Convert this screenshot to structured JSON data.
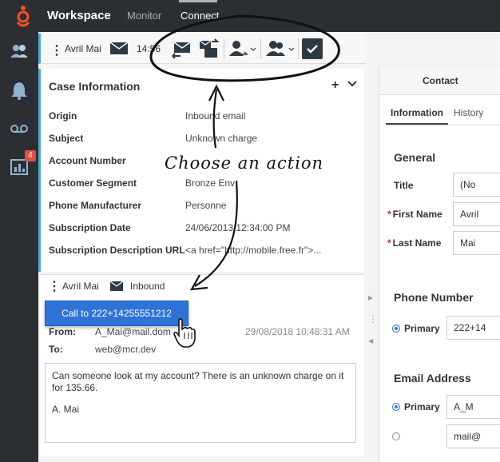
{
  "topbar": {
    "app_title": "Workspace",
    "nav": [
      "Monitor",
      "Connect"
    ]
  },
  "leftbar": {
    "badge_count": "4"
  },
  "toolbar": {
    "name": "Avril Mai",
    "time": "14:56"
  },
  "case": {
    "title": "Case Information",
    "rows": [
      {
        "label": "Origin",
        "value": "Inbound email"
      },
      {
        "label": "Subject",
        "value": "Unknown charge"
      },
      {
        "label": "Account Number",
        "value": ""
      },
      {
        "label": "Customer Segment",
        "value": "Bronze Env"
      },
      {
        "label": "Phone Manufacturer",
        "value": "Personne"
      },
      {
        "label": "Subscription Date",
        "value": "24/06/2013 12:34:00 PM"
      },
      {
        "label": "Subscription Description URL",
        "value": "<a href=\"http://mobile.free.fr\">..."
      }
    ]
  },
  "interaction": {
    "name": "Avril Mai",
    "channel": "Inbound"
  },
  "call_menu": {
    "label": "Call to 222+14255551212"
  },
  "email": {
    "from_label": "From:",
    "from_value": "A_Mai@mail.dom",
    "to_label": "To:",
    "to_value": "web@mcr.dev",
    "date": "29/08/2018 10:48:31 AM",
    "body_line1": "Can someone look at my account? There is an unknown charge on it for 135.66.",
    "body_line2": "A. Mai"
  },
  "contact": {
    "header": "Contact",
    "tabs": [
      "Information",
      "History"
    ],
    "general": "General",
    "title_label": "Title",
    "title_value": "(No",
    "first_name_label": "First Name",
    "first_name_value": "Avril",
    "last_name_label": "Last Name",
    "last_name_value": "Mai",
    "phone_section": "Phone Number",
    "phone_primary_label": "Primary",
    "phone_primary_value": "222+14",
    "email_section": "Email Address",
    "email_primary_label": "Primary",
    "email_primary_value": "A_M",
    "email_secondary_value": "mail@"
  },
  "annotation": {
    "text": "Choose an action"
  },
  "colors": {
    "accent": "#4aa8d8",
    "primary_blue": "#2f73d9",
    "brand_orange": "#ff4f1f",
    "dark": "#2b2f33"
  }
}
